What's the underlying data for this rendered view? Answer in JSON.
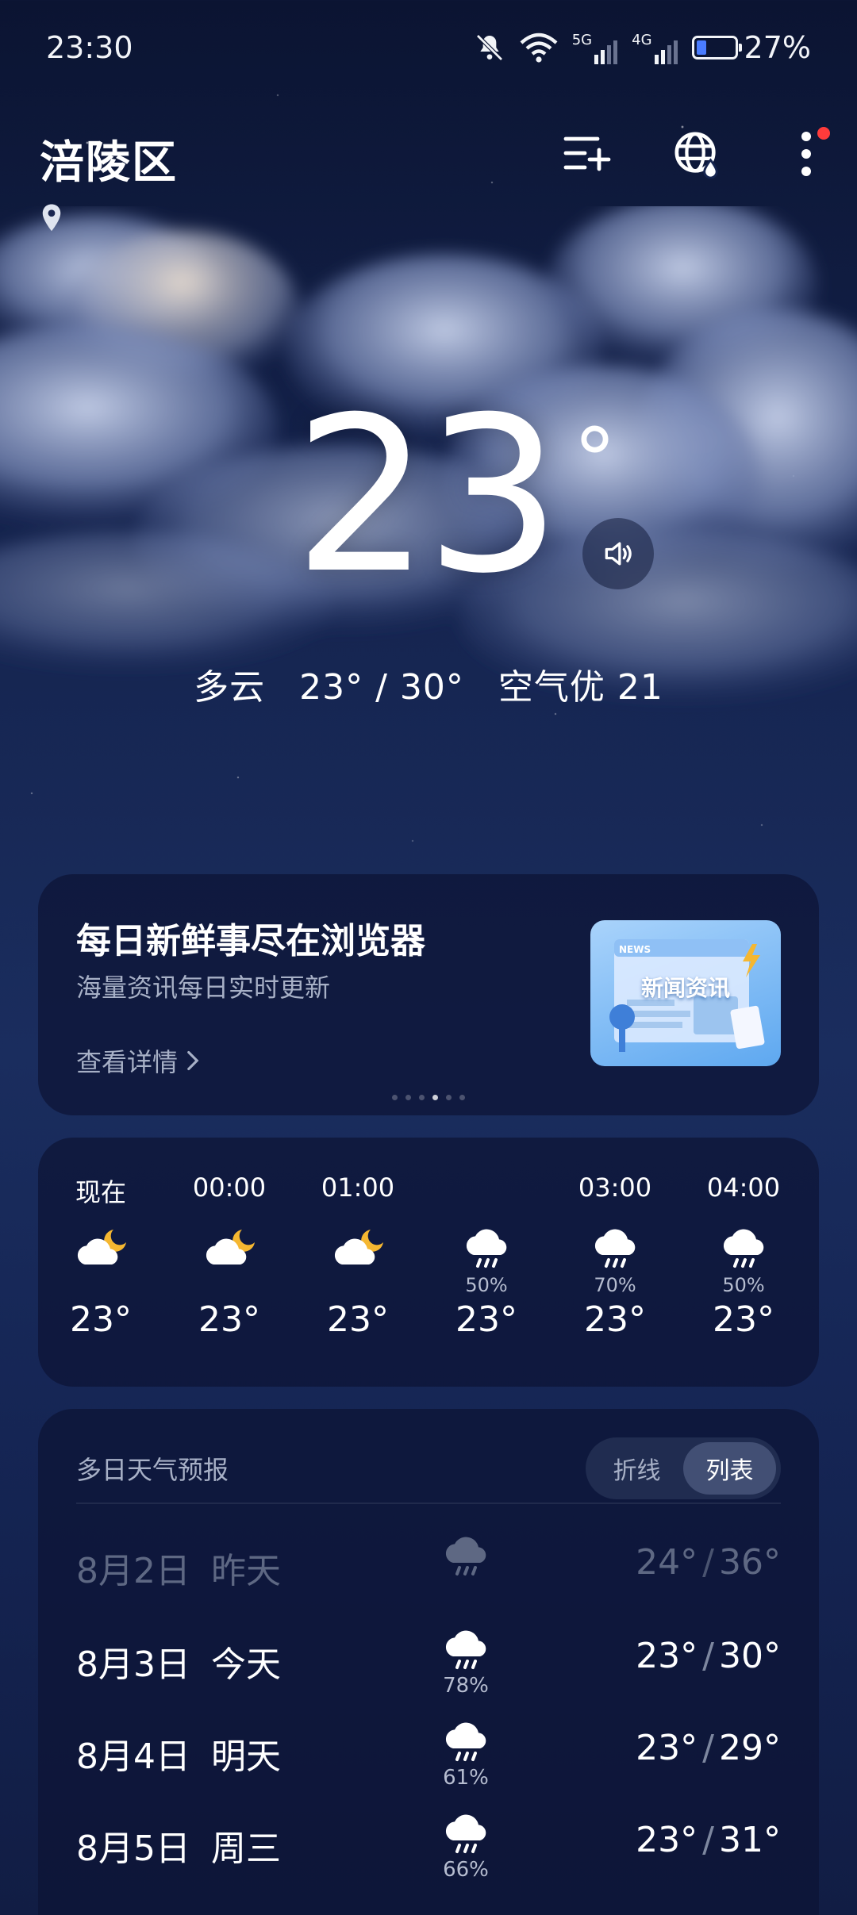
{
  "status_bar": {
    "time": "23:30",
    "signal_5g": "5G",
    "signal_4g": "4G",
    "battery": "27%",
    "battery_level": 0.27
  },
  "header": {
    "city": "涪陵区"
  },
  "current": {
    "temperature": "23",
    "degree": "°",
    "condition": "多云",
    "range": "23° / 30°",
    "air_quality": "空气优 21"
  },
  "ad": {
    "title": "每日新鲜事尽在浏览器",
    "subtitle": "海量资讯每日实时更新",
    "link": "查看详情",
    "image_label": "新闻资讯",
    "image_badge": "NEWS",
    "dots_total": 6,
    "dots_active_index": 3
  },
  "hourly": [
    {
      "time": "现在",
      "icon": "partly-cloudy-night-icon",
      "pop": "",
      "temp": "23°"
    },
    {
      "time": "00:00",
      "icon": "partly-cloudy-night-icon",
      "pop": "",
      "temp": "23°"
    },
    {
      "time": "01:00",
      "icon": "partly-cloudy-night-icon",
      "pop": "",
      "temp": "23°"
    },
    {
      "time": "",
      "icon": "rain-icon",
      "pop": "50%",
      "temp": "23°"
    },
    {
      "time": "03:00",
      "icon": "rain-icon",
      "pop": "70%",
      "temp": "23°"
    },
    {
      "time": "04:00",
      "icon": "rain-icon",
      "pop": "50%",
      "temp": "23°"
    }
  ],
  "daily": {
    "title": "多日天气预报",
    "toggle": {
      "line": "折线",
      "list": "列表",
      "active": "list"
    },
    "rows": [
      {
        "date": "8月2日",
        "name": "昨天",
        "icon": "rain-icon",
        "pop": "",
        "low": "24°",
        "high": "36°",
        "past": true
      },
      {
        "date": "8月3日",
        "name": "今天",
        "icon": "rain-icon",
        "pop": "78%",
        "low": "23°",
        "high": "30°",
        "past": false
      },
      {
        "date": "8月4日",
        "name": "明天",
        "icon": "rain-icon",
        "pop": "61%",
        "low": "23°",
        "high": "29°",
        "past": false
      },
      {
        "date": "8月5日",
        "name": "周三",
        "icon": "rain-icon",
        "pop": "66%",
        "low": "23°",
        "high": "31°",
        "past": false
      }
    ]
  },
  "colors": {
    "accent_sun": "#f5b731",
    "notification_dot": "#ff3b3b",
    "battery_fill": "#4a7cff"
  }
}
